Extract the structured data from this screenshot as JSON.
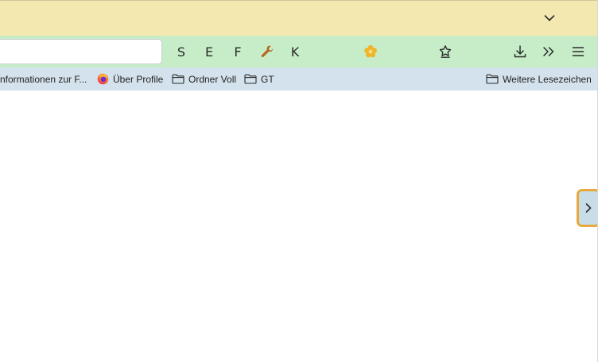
{
  "tabstrip": {
    "list_all_tabs_icon": "chevron-down-icon"
  },
  "navbar": {
    "url": {
      "value": "",
      "placeholder": ""
    },
    "buttons": [
      {
        "label": "S"
      },
      {
        "label": "E"
      },
      {
        "label": "F"
      },
      {
        "icon": "wrench-icon",
        "color": "#b5651d"
      },
      {
        "label": "K"
      },
      {
        "icon": "flower-icon",
        "color": "#f0b429"
      },
      {
        "icon": "star-puzzle-icon"
      },
      {
        "icon": "download-icon"
      },
      {
        "icon": "overflow-chevrons-icon"
      },
      {
        "icon": "hamburger-menu-icon"
      }
    ]
  },
  "bookmarks": {
    "items": [
      {
        "label": "nformationen zur F...",
        "icon": "none"
      },
      {
        "label": "Über Profile",
        "icon": "firefox-icon"
      },
      {
        "label": "Ordner Voll",
        "icon": "folder-icon"
      },
      {
        "label": "GT",
        "icon": "folder-icon"
      }
    ],
    "other": {
      "label": "Weitere Lesezeichen",
      "icon": "folder-icon"
    }
  },
  "colors": {
    "tabstrip_bg": "#f2e8b0",
    "navbar_bg": "#c6edc8",
    "bookmarks_bg": "#d3e2ec",
    "handle_border": "#e7a93a",
    "handle_bg": "#c8dde8"
  }
}
